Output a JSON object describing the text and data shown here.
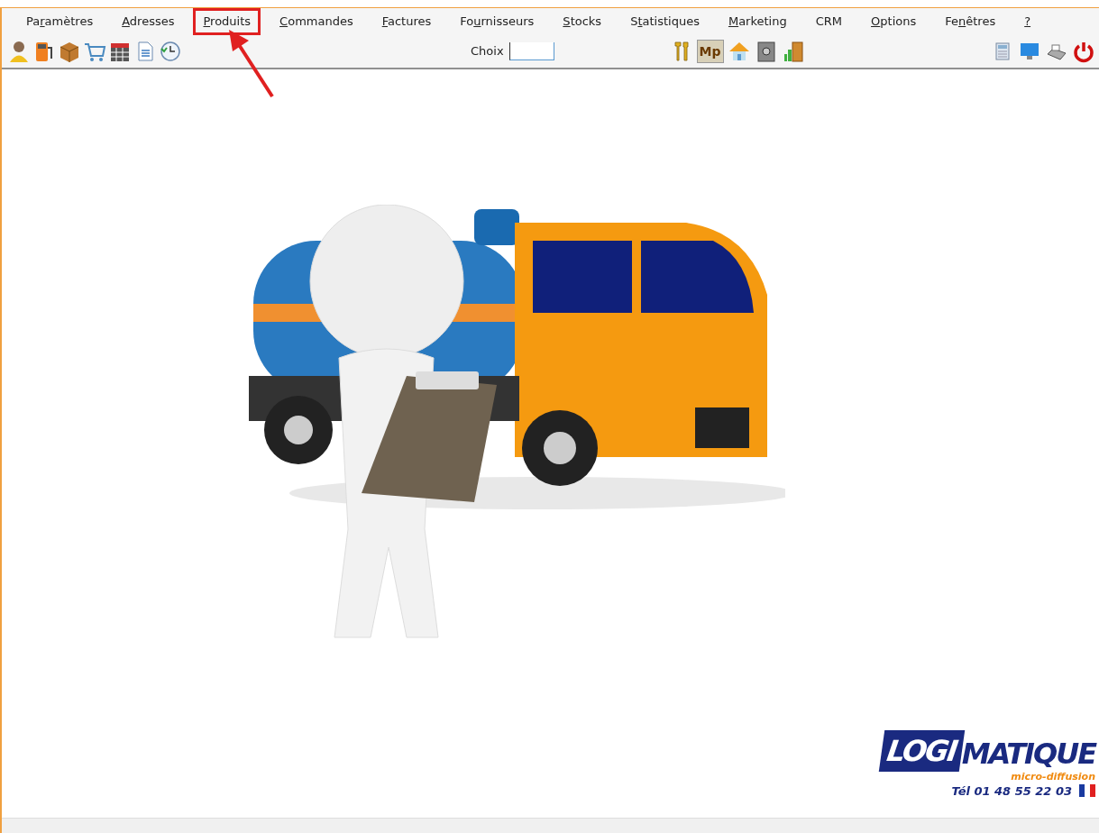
{
  "menu": [
    {
      "pre": "Pa",
      "key": "r",
      "post": "amètres",
      "annotated": false
    },
    {
      "key": "A",
      "post": "dresses",
      "annotated": false
    },
    {
      "key": "P",
      "post": "roduits",
      "annotated": true
    },
    {
      "key": "C",
      "post": "ommandes",
      "annotated": false
    },
    {
      "key": "F",
      "post": "actures",
      "annotated": false
    },
    {
      "pre": "Fo",
      "key": "u",
      "post": "rnisseurs",
      "annotated": false
    },
    {
      "key": "S",
      "post": "tocks",
      "annotated": false
    },
    {
      "pre": "S",
      "key": "t",
      "post": "atistiques",
      "annotated": false
    },
    {
      "key": "M",
      "post": "arketing",
      "annotated": false
    },
    {
      "pre": "CRM",
      "annotated": false
    },
    {
      "key": "O",
      "post": "ptions",
      "annotated": false
    },
    {
      "pre": "Fe",
      "key": "n",
      "post": "êtres",
      "annotated": false
    },
    {
      "key": "?",
      "annotated": false
    }
  ],
  "toolbar": {
    "choice": {
      "label": "Choix"
    },
    "mp_button": "Mp"
  },
  "logo": {
    "brand_left": "LOGI",
    "brand_right": "MATIQUE",
    "tagline": "micro-diffusion",
    "phone": "Tél 01 48 55 22 03"
  }
}
